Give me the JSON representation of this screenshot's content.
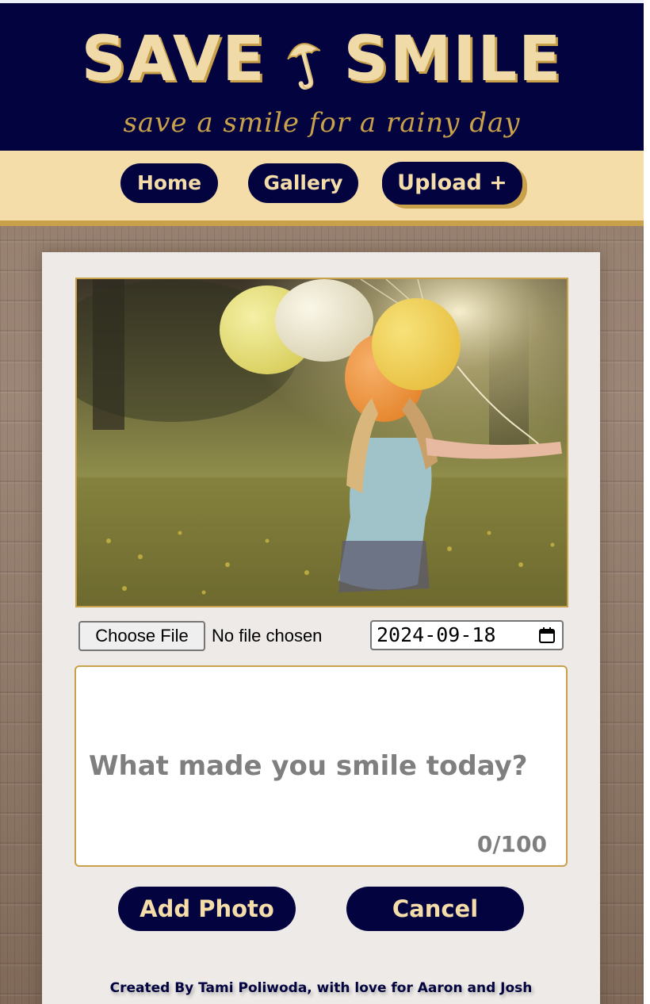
{
  "header": {
    "logo_left": "SAVE",
    "logo_right": "SMILE",
    "logo_mark_icon": "umbrella-icon",
    "tagline": "save a smile for a rainy day"
  },
  "nav": {
    "items": [
      {
        "label": "Home"
      },
      {
        "label": "Gallery"
      },
      {
        "label": "Upload +",
        "active": true
      }
    ]
  },
  "form": {
    "choose_file_label": "Choose File",
    "file_status": "No file chosen",
    "date_value": "2024-09-18",
    "calendar_icon": "calendar-icon",
    "textarea_placeholder": "What made you smile today?",
    "char_counter": "0/100",
    "add_button": "Add Photo",
    "cancel_button": "Cancel"
  },
  "footer": {
    "credit": "Created By Tami Poliwoda, with love for Aaron and Josh"
  },
  "colors": {
    "navy": "#030340",
    "cream": "#f4dda8",
    "gold": "#c9a14a",
    "card": "#edeae7"
  }
}
